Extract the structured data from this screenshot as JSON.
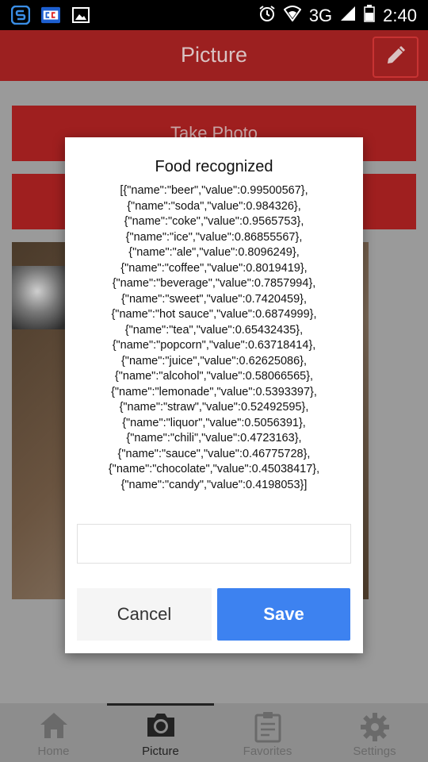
{
  "status_bar": {
    "network": "3G",
    "time": "2:40"
  },
  "header": {
    "title": "Picture"
  },
  "main": {
    "take_photo_label": "Take Photo",
    "second_button_label": ""
  },
  "dialog": {
    "title": "Food recognized",
    "lines": [
      "[{\"name\":\"beer\",\"value\":0.99500567},",
      "{\"name\":\"soda\",\"value\":0.984326},",
      "{\"name\":\"coke\",\"value\":0.9565753},",
      "{\"name\":\"ice\",\"value\":0.86855567},",
      "{\"name\":\"ale\",\"value\":0.8096249},",
      "{\"name\":\"coffee\",\"value\":0.8019419},",
      "{\"name\":\"beverage\",\"value\":0.7857994},",
      "{\"name\":\"sweet\",\"value\":0.7420459},",
      "{\"name\":\"hot sauce\",\"value\":0.6874999},",
      "{\"name\":\"tea\",\"value\":0.65432435},",
      "{\"name\":\"popcorn\",\"value\":0.63718414},",
      "{\"name\":\"juice\",\"value\":0.62625086},",
      "{\"name\":\"alcohol\",\"value\":0.58066565},",
      "{\"name\":\"lemonade\",\"value\":0.5393397},",
      "{\"name\":\"straw\",\"value\":0.52492595},",
      "{\"name\":\"liquor\",\"value\":0.5056391},",
      "{\"name\":\"chili\",\"value\":0.4723163},",
      "{\"name\":\"sauce\",\"value\":0.46775728},",
      "{\"name\":\"chocolate\",\"value\":0.45038417},",
      "{\"name\":\"candy\",\"value\":0.4198053}]"
    ],
    "input_value": "",
    "cancel_label": "Cancel",
    "save_label": "Save"
  },
  "tabs": [
    {
      "label": "Home",
      "icon": "home-icon",
      "active": false
    },
    {
      "label": "Picture",
      "icon": "camera-icon",
      "active": true
    },
    {
      "label": "Favorites",
      "icon": "clipboard-icon",
      "active": false
    },
    {
      "label": "Settings",
      "icon": "gear-icon",
      "active": false
    }
  ],
  "colors": {
    "header": "#9c2020",
    "save_button": "#3d82f0",
    "active_tab": "#222222",
    "inactive_tab": "#6a6a6a"
  }
}
